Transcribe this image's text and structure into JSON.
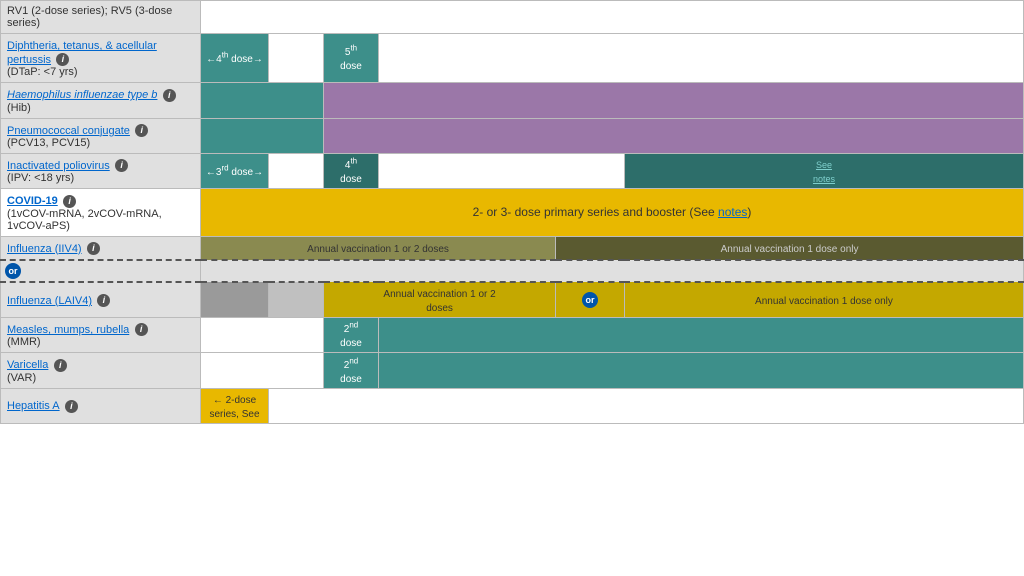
{
  "vaccines": [
    {
      "id": "rv",
      "name": "RV1 (2-dose series); RV5 (3-dose series)",
      "nameLink": false,
      "sub": "",
      "row_bg": "white",
      "cells": [
        {
          "span": 11,
          "text": "",
          "bg": "white"
        }
      ]
    },
    {
      "id": "dtap",
      "name": "Diphtheria, tetanus, & acellular pertussis",
      "nameLink": true,
      "sub": "(DTaP: <7 yrs)",
      "row_bg": "gray",
      "cells": [
        {
          "span": 1,
          "text": "←4th dose→",
          "bg": "teal",
          "textColor": "white"
        },
        {
          "span": 1,
          "text": "",
          "bg": "white"
        },
        {
          "span": 1,
          "text": "5th\ndose",
          "bg": "teal",
          "textColor": "white",
          "sup": true
        },
        {
          "span": 8,
          "text": "",
          "bg": "white"
        }
      ]
    },
    {
      "id": "hib",
      "name": "Haemophilus influenzae type b",
      "nameLink": true,
      "sub": "(Hib)",
      "row_bg": "gray",
      "cells": [
        {
          "span": 2,
          "text": "",
          "bg": "teal"
        },
        {
          "span": 9,
          "text": "",
          "bg": "purple"
        }
      ]
    },
    {
      "id": "pcv",
      "name": "Pneumococcal conjugate",
      "nameLink": true,
      "sub": "(PCV13, PCV15)",
      "row_bg": "gray",
      "cells": [
        {
          "span": 2,
          "text": "",
          "bg": "teal"
        },
        {
          "span": 9,
          "text": "",
          "bg": "purple"
        }
      ]
    },
    {
      "id": "ipv",
      "name": "Inactivated poliovirus",
      "nameLink": true,
      "sub": "(IPV: <18 yrs)",
      "row_bg": "gray",
      "cells": [
        {
          "span": 1,
          "text": "←3rd dose→",
          "bg": "teal",
          "textColor": "white"
        },
        {
          "span": 1,
          "text": "",
          "bg": "white"
        },
        {
          "span": 1,
          "text": "4th\ndose",
          "bg": "teal-dark",
          "textColor": "white",
          "sup": true
        },
        {
          "span": 7,
          "text": "",
          "bg": "white"
        },
        {
          "span": 1,
          "text": "See\nnotes",
          "bg": "teal-dark",
          "textColor": "link"
        }
      ]
    },
    {
      "id": "covid",
      "name": "COVID-19",
      "nameLink": true,
      "sub": "(1vCOV-mRNA, 2vCOV-mRNA, 1vCOV-aPS)",
      "row_bg": "white",
      "cells": [
        {
          "span": 11,
          "text": "2- or 3- dose primary series and booster (See notes)",
          "bg": "gold",
          "textColor": "dark"
        }
      ]
    },
    {
      "id": "influenza-iiv4",
      "name": "Influenza (IIV4)",
      "nameLink": true,
      "sub": "",
      "row_bg": "gray",
      "dashed": true,
      "cells": [
        {
          "span": 5,
          "text": "Annual vaccination 1 or 2 doses",
          "bg": "olive",
          "textColor": "dark"
        },
        {
          "span": 6,
          "text": "Annual vaccination 1 dose only",
          "bg": "olive-dark",
          "textColor": "dark"
        }
      ]
    },
    {
      "id": "or-row",
      "isOrRow": true
    },
    {
      "id": "influenza-laiv4",
      "name": "Influenza (LAIV4)",
      "nameLink": true,
      "sub": "",
      "row_bg": "gray",
      "dashed": true,
      "cells": [
        {
          "span": 1,
          "text": "",
          "bg": "gray"
        },
        {
          "span": 1,
          "text": "",
          "bg": "gray-light"
        },
        {
          "span": 3,
          "text": "Annual vaccination 1 or 2\ndoses",
          "bg": "gold-dark",
          "textColor": "dark"
        },
        {
          "span": 1,
          "text": "or",
          "bg": "gold-dark",
          "textColor": "dark",
          "isOrBadge": true
        },
        {
          "span": 5,
          "text": "Annual vaccination 1 dose only",
          "bg": "gold-dark",
          "textColor": "dark"
        }
      ]
    },
    {
      "id": "mmr",
      "name": "Measles, mumps, rubella",
      "nameLink": true,
      "sub": "(MMR)",
      "row_bg": "gray",
      "cells": [
        {
          "span": 2,
          "text": "",
          "bg": "white"
        },
        {
          "span": 1,
          "text": "2nd\ndose",
          "bg": "teal",
          "textColor": "white",
          "sup": true
        },
        {
          "span": 8,
          "text": "",
          "bg": "teal",
          "textColor": "white"
        }
      ]
    },
    {
      "id": "varicella",
      "name": "Varicella",
      "nameLink": true,
      "sub": "(VAR)",
      "row_bg": "gray",
      "cells": [
        {
          "span": 2,
          "text": "",
          "bg": "white"
        },
        {
          "span": 1,
          "text": "2nd\ndose",
          "bg": "teal",
          "textColor": "white",
          "sup": true
        },
        {
          "span": 8,
          "text": "",
          "bg": "teal",
          "textColor": "white"
        }
      ]
    },
    {
      "id": "hepa",
      "name": "Hepatitis A",
      "nameLink": true,
      "sub": "",
      "row_bg": "gray",
      "cells": [
        {
          "span": 1,
          "text": "← 2-dose series, See",
          "bg": "gold",
          "textColor": "dark"
        },
        {
          "span": 10,
          "text": "",
          "bg": "white"
        }
      ]
    }
  ],
  "colors": {
    "teal": "#3d8f8a",
    "teal_dark": "#2d6e6a",
    "purple": "#9b77a8",
    "gold": "#e8b800",
    "gold_dark": "#c4a800",
    "olive": "#8a8a50",
    "olive_dark": "#5a5a30",
    "gray": "#9a9a9a",
    "gray_light": "#c0c0c0",
    "white": "#ffffff",
    "row_bg": "#e0e0e0"
  },
  "labels": {
    "hepatitis_a": "Hepatitis A",
    "see_notes": "See\nnotes"
  }
}
